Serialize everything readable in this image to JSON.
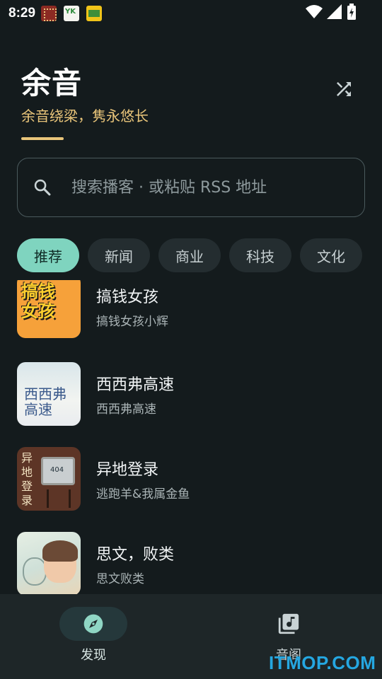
{
  "status_bar": {
    "time": "8:29",
    "notifications": [
      "notification-app-icon",
      "notification-app-icon",
      "notification-app-icon"
    ]
  },
  "header": {
    "title": "余音",
    "subtitle": "余音绕梁，隽永悠长",
    "accent_color": "#e9c57a",
    "shuffle_icon": "shuffle-icon"
  },
  "search": {
    "placeholder": "搜索播客 · 或粘贴 RSS 地址",
    "icon": "search-icon"
  },
  "categories": {
    "chips": [
      "推荐",
      "新闻",
      "商业",
      "科技",
      "文化"
    ],
    "selected": "推荐",
    "selected_color": "#7fd4bf"
  },
  "podcasts": [
    {
      "title": "搞钱女孩",
      "author": "搞钱女孩小辉",
      "cover_text": "搞钱\n女孩"
    },
    {
      "title": "西西弗高速",
      "author": "西西弗高速",
      "cover_text": "西西弗\n高速"
    },
    {
      "title": "异地登录",
      "author": "逃跑羊&我属金鱼",
      "cover_text": "异地登录"
    },
    {
      "title": "思文，败类",
      "author": "思文败类"
    }
  ],
  "bottom_nav": {
    "items": [
      {
        "label": "发现",
        "icon": "compass-icon",
        "active": true
      },
      {
        "label": "音阁",
        "icon": "library-music-icon",
        "active": false
      }
    ]
  },
  "watermark": "ITMOP.COM"
}
